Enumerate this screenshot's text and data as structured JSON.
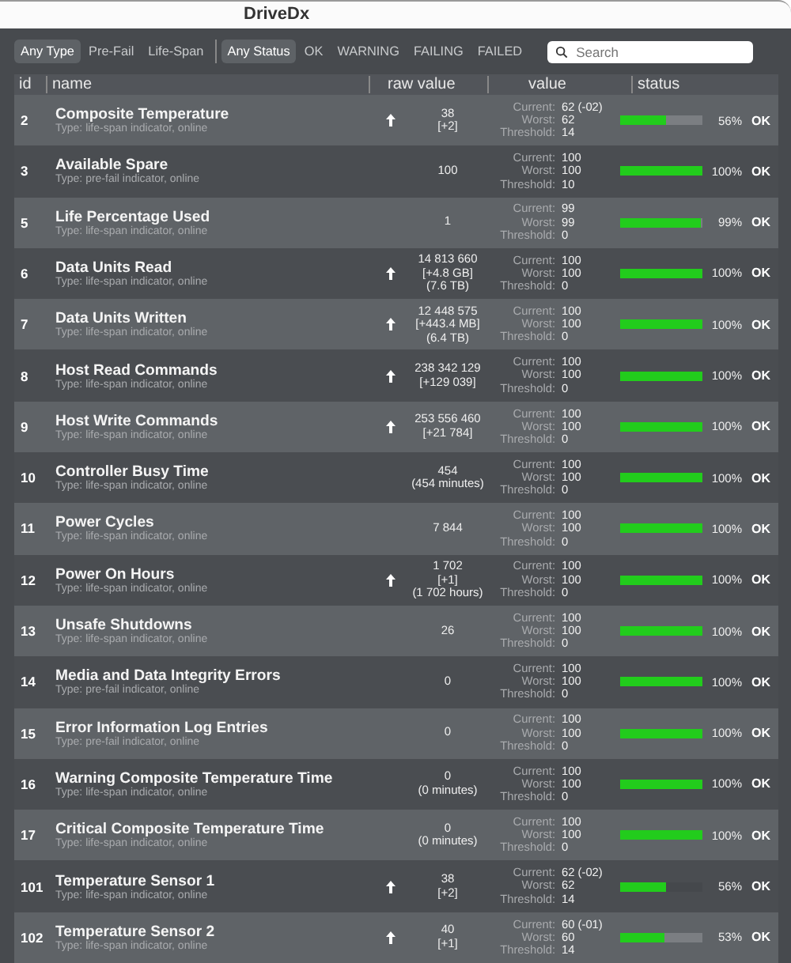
{
  "window": {
    "title": "DriveDx"
  },
  "type_filters": [
    {
      "label": "Any Type",
      "selected": true
    },
    {
      "label": "Pre-Fail",
      "selected": false
    },
    {
      "label": "Life-Span",
      "selected": false
    }
  ],
  "status_filters": [
    {
      "label": "Any Status",
      "selected": true
    },
    {
      "label": "OK",
      "selected": false
    },
    {
      "label": "WARNING",
      "selected": false
    },
    {
      "label": "FAILING",
      "selected": false
    },
    {
      "label": "FAILED",
      "selected": false
    }
  ],
  "search": {
    "placeholder": "Search"
  },
  "columns": [
    "id",
    "name",
    "raw value",
    "value",
    "status"
  ],
  "rows": [
    {
      "id": "2",
      "name": "Composite Temperature",
      "type": "Type: life-span indicator, online",
      "trend_up": true,
      "raw": [
        "38",
        "[+2]"
      ],
      "current_label": "Current:",
      "current": "62 (-02)",
      "worst_label": "Worst:",
      "worst": "62",
      "threshold_label": "Threshold:",
      "threshold": "14",
      "level": 0.56,
      "percent": "56%",
      "status": "OK"
    },
    {
      "id": "3",
      "name": "Available Spare",
      "type": "Type: pre-fail indicator, online",
      "trend_up": false,
      "raw": [
        "100"
      ],
      "current_label": "Current:",
      "current": "100",
      "worst_label": "Worst:",
      "worst": "100",
      "threshold_label": "Threshold:",
      "threshold": "10",
      "level": 1,
      "percent": "100%",
      "status": "OK"
    },
    {
      "id": "5",
      "name": "Life Percentage Used",
      "type": "Type: life-span indicator, online",
      "trend_up": false,
      "raw": [
        "1"
      ],
      "current_label": "Current:",
      "current": "99",
      "worst_label": "Worst:",
      "worst": "99",
      "threshold_label": "Threshold:",
      "threshold": "0",
      "level": 0.99,
      "percent": "99%",
      "status": "OK"
    },
    {
      "id": "6",
      "name": "Data Units Read",
      "type": "Type: life-span indicator, online",
      "trend_up": true,
      "raw": [
        "14 813 660",
        "[+4.8 GB]",
        "(7.6 TB)"
      ],
      "current_label": "Current:",
      "current": "100",
      "worst_label": "Worst:",
      "worst": "100",
      "threshold_label": "Threshold:",
      "threshold": "0",
      "level": 1,
      "percent": "100%",
      "status": "OK"
    },
    {
      "id": "7",
      "name": "Data Units Written",
      "type": "Type: life-span indicator, online",
      "trend_up": true,
      "raw": [
        "12 448 575",
        "[+443.4 MB]",
        "(6.4 TB)"
      ],
      "current_label": "Current:",
      "current": "100",
      "worst_label": "Worst:",
      "worst": "100",
      "threshold_label": "Threshold:",
      "threshold": "0",
      "level": 1,
      "percent": "100%",
      "status": "OK"
    },
    {
      "id": "8",
      "name": "Host Read Commands",
      "type": "Type: life-span indicator, online",
      "trend_up": true,
      "raw": [
        "238 342 129",
        "[+129 039]"
      ],
      "current_label": "Current:",
      "current": "100",
      "worst_label": "Worst:",
      "worst": "100",
      "threshold_label": "Threshold:",
      "threshold": "0",
      "level": 1,
      "percent": "100%",
      "status": "OK"
    },
    {
      "id": "9",
      "name": "Host Write Commands",
      "type": "Type: life-span indicator, online",
      "trend_up": true,
      "raw": [
        "253 556 460",
        "[+21 784]"
      ],
      "current_label": "Current:",
      "current": "100",
      "worst_label": "Worst:",
      "worst": "100",
      "threshold_label": "Threshold:",
      "threshold": "0",
      "level": 1,
      "percent": "100%",
      "status": "OK"
    },
    {
      "id": "10",
      "name": "Controller Busy Time",
      "type": "Type: life-span indicator, online",
      "trend_up": false,
      "raw": [
        "454",
        "(454 minutes)"
      ],
      "current_label": "Current:",
      "current": "100",
      "worst_label": "Worst:",
      "worst": "100",
      "threshold_label": "Threshold:",
      "threshold": "0",
      "level": 1,
      "percent": "100%",
      "status": "OK"
    },
    {
      "id": "11",
      "name": "Power Cycles",
      "type": "Type: life-span indicator, online",
      "trend_up": false,
      "raw": [
        "7 844"
      ],
      "current_label": "Current:",
      "current": "100",
      "worst_label": "Worst:",
      "worst": "100",
      "threshold_label": "Threshold:",
      "threshold": "0",
      "level": 1,
      "percent": "100%",
      "status": "OK"
    },
    {
      "id": "12",
      "name": "Power On Hours",
      "type": "Type: life-span indicator, online",
      "trend_up": true,
      "raw": [
        "1 702",
        "[+1]",
        "(1 702 hours)"
      ],
      "current_label": "Current:",
      "current": "100",
      "worst_label": "Worst:",
      "worst": "100",
      "threshold_label": "Threshold:",
      "threshold": "0",
      "level": 1,
      "percent": "100%",
      "status": "OK"
    },
    {
      "id": "13",
      "name": "Unsafe Shutdowns",
      "type": "Type: life-span indicator, online",
      "trend_up": false,
      "raw": [
        "26"
      ],
      "current_label": "Current:",
      "current": "100",
      "worst_label": "Worst:",
      "worst": "100",
      "threshold_label": "Threshold:",
      "threshold": "0",
      "level": 1,
      "percent": "100%",
      "status": "OK"
    },
    {
      "id": "14",
      "name": "Media and Data Integrity Errors",
      "type": "Type: pre-fail indicator, online",
      "trend_up": false,
      "raw": [
        "0"
      ],
      "current_label": "Current:",
      "current": "100",
      "worst_label": "Worst:",
      "worst": "100",
      "threshold_label": "Threshold:",
      "threshold": "0",
      "level": 1,
      "percent": "100%",
      "status": "OK"
    },
    {
      "id": "15",
      "name": "Error Information Log Entries",
      "type": "Type: pre-fail indicator, online",
      "trend_up": false,
      "raw": [
        "0"
      ],
      "current_label": "Current:",
      "current": "100",
      "worst_label": "Worst:",
      "worst": "100",
      "threshold_label": "Threshold:",
      "threshold": "0",
      "level": 1,
      "percent": "100%",
      "status": "OK"
    },
    {
      "id": "16",
      "name": "Warning Composite Temperature Time",
      "type": "Type: life-span indicator, online",
      "trend_up": false,
      "raw": [
        "0",
        "(0 minutes)"
      ],
      "current_label": "Current:",
      "current": "100",
      "worst_label": "Worst:",
      "worst": "100",
      "threshold_label": "Threshold:",
      "threshold": "0",
      "level": 1,
      "percent": "100%",
      "status": "OK"
    },
    {
      "id": "17",
      "name": "Critical Composite Temperature Time",
      "type": "Type: life-span indicator, online",
      "trend_up": false,
      "raw": [
        "0",
        "(0 minutes)"
      ],
      "current_label": "Current:",
      "current": "100",
      "worst_label": "Worst:",
      "worst": "100",
      "threshold_label": "Threshold:",
      "threshold": "0",
      "level": 1,
      "percent": "100%",
      "status": "OK"
    },
    {
      "id": "101",
      "name": "Temperature Sensor 1",
      "type": "Type: life-span indicator, online",
      "trend_up": true,
      "raw": [
        "38",
        "[+2]"
      ],
      "current_label": "Current:",
      "current": "62 (-02)",
      "worst_label": "Worst:",
      "worst": "62",
      "threshold_label": "Threshold:",
      "threshold": "14",
      "level": 0.56,
      "percent": "56%",
      "status": "OK"
    },
    {
      "id": "102",
      "name": "Temperature Sensor 2",
      "type": "Type: life-span indicator, online",
      "trend_up": true,
      "raw": [
        "40",
        "[+1]"
      ],
      "current_label": "Current:",
      "current": "60 (-01)",
      "worst_label": "Worst:",
      "worst": "60",
      "threshold_label": "Threshold:",
      "threshold": "14",
      "level": 0.53,
      "percent": "53%",
      "status": "OK"
    }
  ]
}
